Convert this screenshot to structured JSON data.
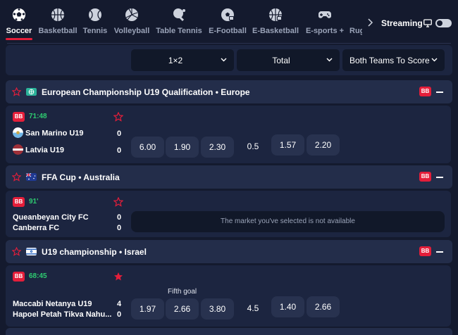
{
  "nav": {
    "sports": [
      {
        "label": "Soccer",
        "icon": "soccer-ball-icon",
        "active": true
      },
      {
        "label": "Basketball",
        "icon": "basketball-icon"
      },
      {
        "label": "Tennis",
        "icon": "tennis-ball-icon"
      },
      {
        "label": "Volleyball",
        "icon": "volleyball-icon"
      },
      {
        "label": "Table Tennis",
        "icon": "table-tennis-icon"
      },
      {
        "label": "E-Football",
        "icon": "e-football-icon"
      },
      {
        "label": "E-Basketball",
        "icon": "e-basketball-icon"
      },
      {
        "label": "E-sports +",
        "icon": "gamepad-icon"
      },
      {
        "label": "Rug",
        "icon": "rugby-icon"
      }
    ],
    "streaming_label": "Streaming"
  },
  "markets": {
    "col1": "1×2",
    "col2": "Total",
    "col3": "Both Teams To Score"
  },
  "tournaments": [
    {
      "name": "European Championship U19 Qualification • Europe",
      "bb": "BB",
      "match": {
        "bb": "BB",
        "time": "71:48",
        "team1": "San Marino U19",
        "team2": "Latvia U19",
        "score1": "0",
        "score2": "0",
        "odds_1x2": [
          "6.00",
          "1.90",
          "2.30"
        ],
        "total_param": "0.5",
        "total_odds": [
          "1.57",
          "2.20"
        ]
      }
    },
    {
      "name": "FFA Cup • Australia",
      "bb": "BB",
      "match": {
        "bb": "BB",
        "time": "91'",
        "team1": "Queanbeyan City FC",
        "team2": "Canberra FC",
        "score1": "0",
        "score2": "0",
        "unavailable": "The market you've selected is not available"
      }
    },
    {
      "name": "U19 championship • Israel",
      "bb": "BB",
      "match": {
        "bb": "BB",
        "time": "68:45",
        "team1": "Maccabi Netanya U19",
        "team2": "Hapoel Petah Tikva Nahu...",
        "score1": "4",
        "score2": "0",
        "note": "Fifth goal",
        "odds_1x2": [
          "1.97",
          "2.66",
          "3.80"
        ],
        "total_param": "4.5",
        "total_odds": [
          "1.40",
          "2.66"
        ]
      }
    }
  ],
  "colors": {
    "accent": "#e41e3a",
    "live_time": "#2ecc71",
    "background": "#141a2e"
  }
}
